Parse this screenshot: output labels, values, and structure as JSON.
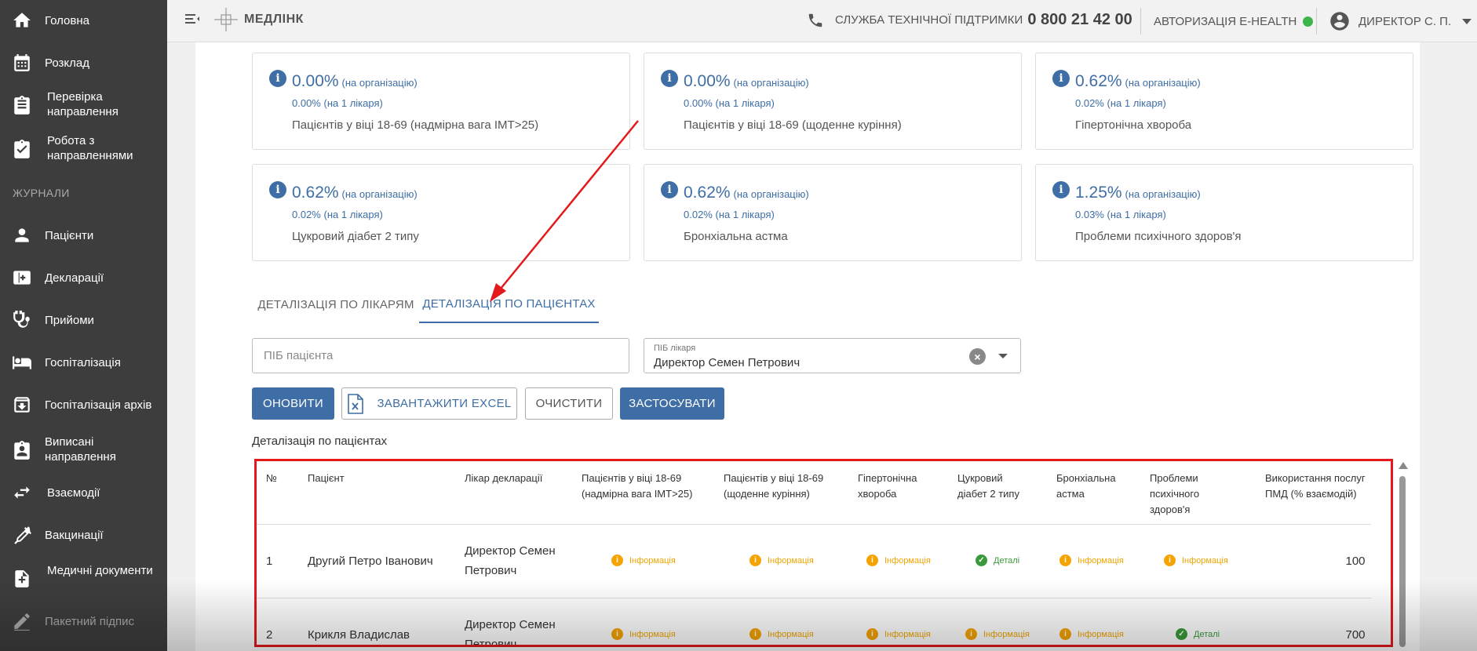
{
  "sidebar": {
    "items": [
      {
        "label": "Головна",
        "icon": "home-icon"
      },
      {
        "label": "Розклад",
        "icon": "calendar-icon"
      },
      {
        "label": "Перевірка направлення",
        "icon": "clipboard-check-icon"
      },
      {
        "label": "Робота з направленнями",
        "icon": "clipboard-icon"
      },
      {
        "label": "Пацієнти",
        "icon": "person-icon"
      },
      {
        "label": "Декларації",
        "icon": "medical-card-icon"
      },
      {
        "label": "Прийоми",
        "icon": "stethoscope-icon"
      },
      {
        "label": "Госпіталізація",
        "icon": "bed-icon"
      },
      {
        "label": "Госпіталізація архів",
        "icon": "archive-icon"
      },
      {
        "label": "Виписані направлення",
        "icon": "clipboard-list-icon"
      },
      {
        "label": "Взаємодії",
        "icon": "swap-icon"
      },
      {
        "label": "Вакцинації",
        "icon": "syringe-icon"
      },
      {
        "label": "Медичні документи",
        "icon": "document-add-icon"
      },
      {
        "label": "Пакетний підпис",
        "icon": "signature-icon"
      }
    ],
    "section_label": "ЖУРНАЛИ"
  },
  "header": {
    "logo_text": "МЕДЛІНК",
    "support_label": "СЛУЖБА ТЕХНІЧНОЇ ПІДТРИМКИ",
    "support_phone": "0 800 21 42 00",
    "ehealth_label": "АВТОРИЗАЦІЯ E-HEALTH",
    "ehealth_status_color": "#3cb54a",
    "user_name": "ДИРЕКТОР С. П."
  },
  "stats": [
    {
      "pct": "0.00%",
      "pct_note": "(на організацію)",
      "sub": "0.00%",
      "sub_note": "(на 1 лікаря)",
      "desc": "Пацієнтів у віці 18-69 (надмірна вага ІМТ>25)"
    },
    {
      "pct": "0.00%",
      "pct_note": "(на організацію)",
      "sub": "0.00%",
      "sub_note": "(на 1 лікаря)",
      "desc": "Пацієнтів у віці 18-69 (щоденне куріння)"
    },
    {
      "pct": "0.62%",
      "pct_note": "(на організацію)",
      "sub": "0.02%",
      "sub_note": "(на 1 лікаря)",
      "desc": "Гіпертонічна хвороба"
    },
    {
      "pct": "0.62%",
      "pct_note": "(на організацію)",
      "sub": "0.02%",
      "sub_note": "(на 1 лікаря)",
      "desc": "Цукровий діабет 2 типу"
    },
    {
      "pct": "0.62%",
      "pct_note": "(на організацію)",
      "sub": "0.02%",
      "sub_note": "(на 1 лікаря)",
      "desc": "Бронхіальна астма"
    },
    {
      "pct": "1.25%",
      "pct_note": "(на організацію)",
      "sub": "0.03%",
      "sub_note": "(на 1 лікаря)",
      "desc": "Проблеми психічного здоров'я"
    }
  ],
  "tabs": [
    {
      "label": "ДЕТАЛІЗАЦІЯ ПО ЛІКАРЯМ"
    },
    {
      "label": "ДЕТАЛІЗАЦІЯ ПО ПАЦІЄНТАХ"
    }
  ],
  "filters": {
    "patient_placeholder": "ПІБ пацієнта",
    "doctor_label": "ПІБ лікаря",
    "doctor_value": "Директор Семен Петрович"
  },
  "buttons": {
    "refresh": "ОНОВИТИ",
    "excel": "ЗАВАНТАЖИТИ EXCEL",
    "clear": "ОЧИСТИТИ",
    "apply": "ЗАСТОСУВАТИ"
  },
  "section_title": "Деталізація по пацієнтах",
  "table": {
    "headers": [
      "№",
      "Пацієнт",
      "Лікар декларації",
      "Пацієнтів у віці 18-69 (надмірна вага ІМТ>25)",
      "Пацієнтів у віці 18-69 (щоденне куріння)",
      "Гіпертонічна хвороба",
      "Цукровий діабет 2 типу",
      "Бронхіальна астма",
      "Проблеми психічного здоров'я",
      "Використання послуг ПМД (% взаємодій)"
    ],
    "rows": [
      {
        "num": "1",
        "patient": "Другий Петро Іванович",
        "doctor": "Директор Семен Петрович",
        "c1": "Інформація",
        "c2": "Інформація",
        "c3": "Інформація",
        "c4": "Деталі",
        "c5": "Інформація",
        "c6": "Інформація",
        "pmd": "100"
      },
      {
        "num": "2",
        "patient": "Крикля Владислав",
        "doctor": "Директор Семен Петрович",
        "c1": "Інформація",
        "c2": "Інформація",
        "c3": "Інформація",
        "c4": "Інформація",
        "c5": "Інформація",
        "c6": "Деталі",
        "pmd": "700"
      }
    ]
  },
  "colors": {
    "accent": "#3e6ea5",
    "info": "#f5a300",
    "ok": "#3a9a3a",
    "highlight": "#e3191b"
  }
}
